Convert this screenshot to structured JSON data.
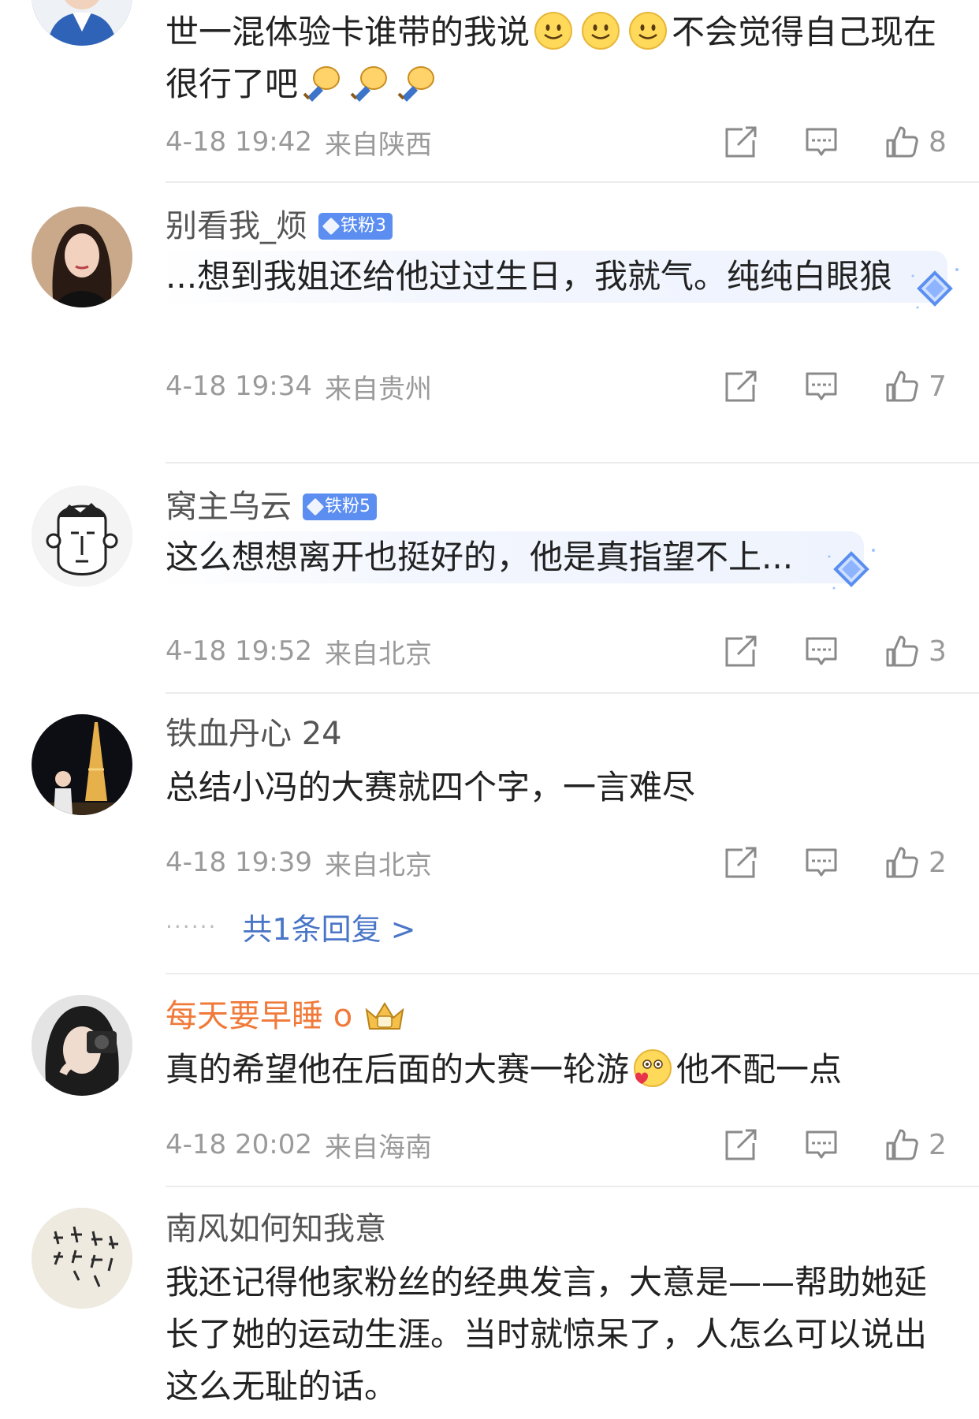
{
  "comments": [
    {
      "text_parts": [
        "世一混体验卡谁带的我说",
        "不会觉得自己现在很行了吧"
      ],
      "time": "4-18 19:42",
      "location": "来自陕西",
      "likes": "8"
    },
    {
      "username": "别看我_烦",
      "badge": "铁粉3",
      "text": "...想到我姐还给他过过生日，我就气。纯纯白眼狼",
      "time": "4-18 19:34",
      "location": "来自贵州",
      "likes": "7"
    },
    {
      "username": "窝主乌云",
      "badge": "铁粉5",
      "text": "这么想想离开也挺好的，他是真指望不上...",
      "time": "4-18 19:52",
      "location": "来自北京",
      "likes": "3"
    },
    {
      "username": "铁血丹心 24",
      "text": "总结小冯的大赛就四个字，一言难尽",
      "time": "4-18 19:39",
      "location": "来自北京",
      "likes": "2",
      "reply_dots": "······",
      "reply_label": "共1条回复 >"
    },
    {
      "username": "每天要早睡 o",
      "text_parts": [
        "真的希望他在后面的大赛一轮游",
        "他不配一点"
      ],
      "time": "4-18 20:02",
      "location": "来自海南",
      "likes": "2"
    },
    {
      "username": "南风如何知我意",
      "text": "我还记得他家粉丝的经典发言，大意是——帮助她延长了她的运动生涯。当时就惊呆了，人怎么可以说出这么无耻的话。"
    }
  ],
  "colors": {
    "link": "#4a76c7",
    "vip_name": "#f07a3a",
    "badge": "#5b8ef0",
    "meta": "#9a9a9a"
  },
  "icons": [
    "share-icon",
    "comment-icon",
    "thumbs-up-icon",
    "smile-emoji-icon",
    "fist-emoji-icon",
    "diamond-decoration-icon",
    "crown-icon"
  ]
}
